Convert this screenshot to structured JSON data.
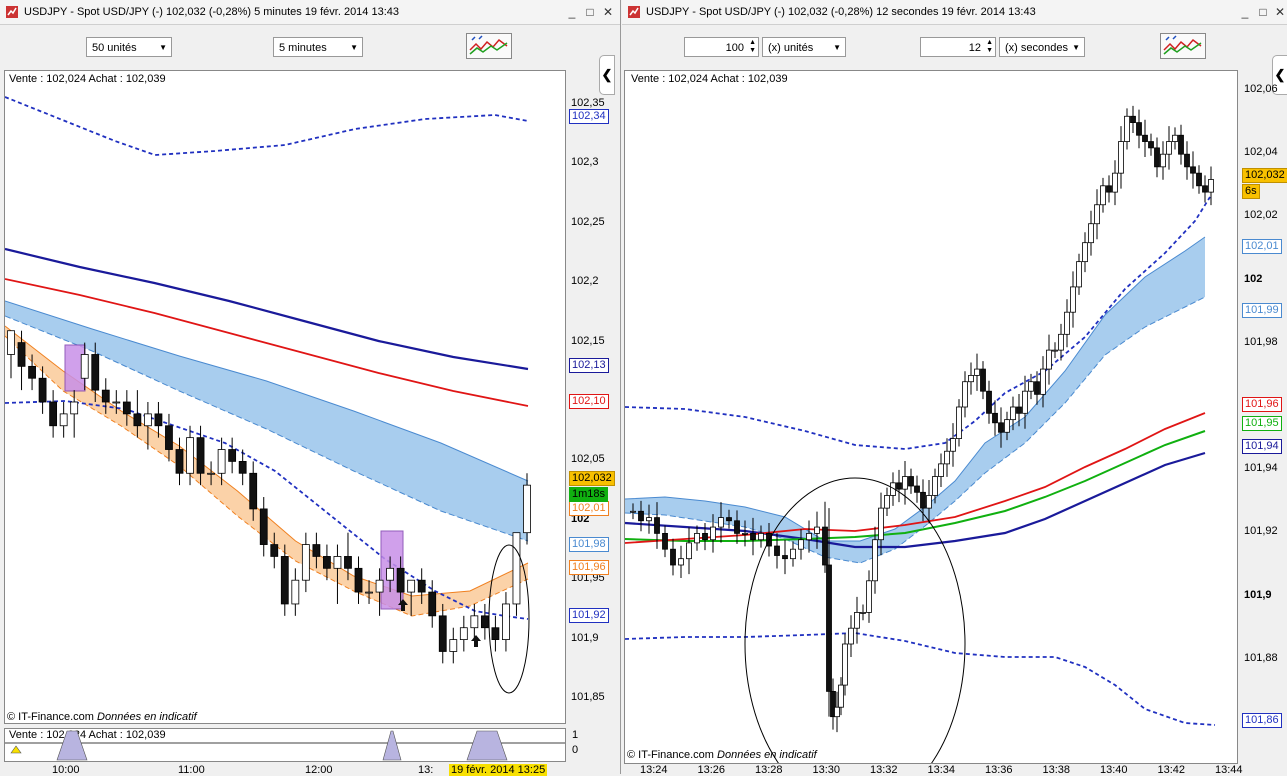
{
  "left_window": {
    "title": "USDJPY - Spot USD/JPY (-)    102,032 (-0,28%)    5 minutes   19 févr. 2014 13:43",
    "controls": [
      "_",
      "□",
      "✕"
    ],
    "units_select": "50 unités",
    "period_select": "5 minutes",
    "quote_line": "Vente : 102,024 Achat : 102,039",
    "sub_quote_line": "Vente : 102,024 Achat : 102,039",
    "copyright": "© IT-Finance.com",
    "disclaimer": "Données en indicatif",
    "sub_axis": [
      "1",
      "0"
    ],
    "cursor_date": "19 févr. 2014 13:25"
  },
  "right_window": {
    "title": "USDJPY - Spot USD/JPY (-)    102,032 (-0,28%)    12 secondes   19 févr. 2014 13:43",
    "controls": [
      "_",
      "□",
      "✕"
    ],
    "units_value": "100",
    "units_select": "(x) unités",
    "period_value": "12",
    "period_select": "(x) secondes",
    "quote_line": "Vente : 102,024 Achat : 102,039",
    "copyright": "© IT-Finance.com",
    "disclaimer": "Données en indicatif"
  },
  "colors": {
    "band_blue": "#a8cdee",
    "band_orange": "#fbd2a8",
    "dark_blue": "#1a1a9a",
    "red": "#e01515",
    "green": "#10b010",
    "dotted_blue": "#2030c0",
    "orange_line": "#f08020",
    "purple": "#b070d8",
    "yellow": "#f8e000",
    "price_box": "#f8c000"
  },
  "chart_data": [
    {
      "type": "candlestick",
      "title": "USDJPY 5 minutes",
      "y_ticks": [
        "102,35",
        "102,3",
        "102,25",
        "102,2",
        "102,15",
        "102,1",
        "102,05",
        "102",
        "101,95",
        "101,9",
        "101,85"
      ],
      "x_ticks": [
        "10:00",
        "11:00",
        "12:00",
        "13:"
      ],
      "ylim": [
        101.83,
        102.37
      ],
      "value_tags": [
        {
          "label": "102,34",
          "color": "#2030c0"
        },
        {
          "label": "102,13",
          "color": "#1a1a9a"
        },
        {
          "label": "102,10",
          "color": "#e01515"
        },
        {
          "label": "101,98",
          "color": "#4a8ad0"
        },
        {
          "label": "101,96",
          "color": "#f08020"
        },
        {
          "label": "101,92",
          "color": "#2030c0"
        },
        {
          "label": "102,01",
          "color": "#f08020"
        },
        {
          "label": "1m18s",
          "color": "#10b010"
        },
        {
          "label": "102,032",
          "color": "#f8c000"
        }
      ],
      "series": [
        {
          "name": "",
          "values": [
            102.33,
            102.3,
            102.31,
            102.32,
            102.32,
            102.33
          ]
        },
        {
          "name": "",
          "values": [
            102.21,
            102.19,
            102.17,
            102.15,
            102.13
          ]
        },
        {
          "name": "",
          "values": [
            102.18,
            102.16,
            102.14,
            102.12,
            102.1
          ]
        }
      ],
      "candles": [
        [
          102.14,
          102.16,
          102.12,
          102.16
        ],
        [
          102.15,
          102.16,
          102.11,
          102.13
        ],
        [
          102.13,
          102.14,
          102.11,
          102.12
        ],
        [
          102.12,
          102.13,
          102.09,
          102.1
        ],
        [
          102.1,
          102.11,
          102.07,
          102.08
        ],
        [
          102.08,
          102.1,
          102.07,
          102.09
        ],
        [
          102.09,
          102.11,
          102.07,
          102.1
        ],
        [
          102.12,
          102.15,
          102.11,
          102.14
        ],
        [
          102.14,
          102.15,
          102.1,
          102.11
        ],
        [
          102.11,
          102.12,
          102.09,
          102.1
        ],
        [
          102.1,
          102.11,
          102.09,
          102.1
        ],
        [
          102.1,
          102.11,
          102.08,
          102.09
        ],
        [
          102.09,
          102.11,
          102.07,
          102.08
        ],
        [
          102.08,
          102.1,
          102.06,
          102.09
        ],
        [
          102.09,
          102.1,
          102.07,
          102.08
        ],
        [
          102.08,
          102.09,
          102.05,
          102.06
        ],
        [
          102.06,
          102.07,
          102.03,
          102.04
        ],
        [
          102.04,
          102.08,
          102.03,
          102.07
        ],
        [
          102.07,
          102.08,
          102.03,
          102.04
        ],
        [
          102.04,
          102.05,
          102.03,
          102.04
        ],
        [
          102.04,
          102.07,
          102.03,
          102.06
        ],
        [
          102.06,
          102.07,
          102.04,
          102.05
        ],
        [
          102.05,
          102.06,
          102.03,
          102.04
        ],
        [
          102.04,
          102.05,
          102.0,
          102.01
        ],
        [
          102.01,
          102.02,
          101.97,
          101.98
        ],
        [
          101.98,
          101.99,
          101.96,
          101.97
        ],
        [
          101.97,
          101.98,
          101.92,
          101.93
        ],
        [
          101.93,
          101.96,
          101.92,
          101.95
        ],
        [
          101.95,
          101.99,
          101.94,
          101.98
        ],
        [
          101.98,
          101.99,
          101.96,
          101.97
        ],
        [
          101.97,
          101.98,
          101.95,
          101.96
        ],
        [
          101.96,
          101.98,
          101.93,
          101.97
        ],
        [
          101.97,
          101.99,
          101.95,
          101.96
        ],
        [
          101.96,
          101.97,
          101.93,
          101.94
        ],
        [
          101.94,
          101.95,
          101.93,
          101.94
        ],
        [
          101.94,
          101.96,
          101.92,
          101.95
        ],
        [
          101.95,
          101.97,
          101.94,
          101.96
        ],
        [
          101.96,
          101.97,
          101.93,
          101.94
        ],
        [
          101.94,
          101.95,
          101.92,
          101.95
        ],
        [
          101.95,
          101.96,
          101.93,
          101.94
        ],
        [
          101.94,
          101.95,
          101.91,
          101.92
        ],
        [
          101.92,
          101.93,
          101.88,
          101.89
        ],
        [
          101.89,
          101.91,
          101.88,
          101.9
        ],
        [
          101.9,
          101.92,
          101.89,
          101.91
        ],
        [
          101.91,
          101.93,
          101.9,
          101.92
        ],
        [
          101.92,
          101.93,
          101.9,
          101.91
        ],
        [
          101.91,
          101.92,
          101.89,
          101.9
        ],
        [
          101.9,
          101.94,
          101.89,
          101.93
        ],
        [
          101.93,
          101.99,
          101.92,
          101.99
        ],
        [
          101.99,
          102.04,
          101.98,
          102.03
        ]
      ]
    },
    {
      "type": "candlestick",
      "title": "USDJPY 12 secondes",
      "y_ticks": [
        "102,06",
        "102,04",
        "102,02",
        "102",
        "101,98",
        "101,96",
        "101,94",
        "101,92",
        "101,9",
        "101,88",
        "101,86"
      ],
      "x_ticks": [
        "13:24",
        "13:26",
        "13:28",
        "13:30",
        "13:32",
        "13:34",
        "13:36",
        "13:38",
        "13:40",
        "13:42",
        "13:44"
      ],
      "ylim": [
        101.855,
        102.065
      ],
      "value_tags": [
        {
          "label": "102,032",
          "color": "#f8c000"
        },
        {
          "label": "6s",
          "color": "#f8c000"
        },
        {
          "label": "102,01",
          "color": "#4a8ad0"
        },
        {
          "label": "101,99",
          "color": "#4a8ad0"
        },
        {
          "label": "101,96",
          "color": "#e01515"
        },
        {
          "label": "101,95",
          "color": "#10b010"
        },
        {
          "label": "101,94",
          "color": "#1a1a9a"
        },
        {
          "label": "101,86",
          "color": "#2030c0"
        }
      ],
      "candles": []
    }
  ]
}
